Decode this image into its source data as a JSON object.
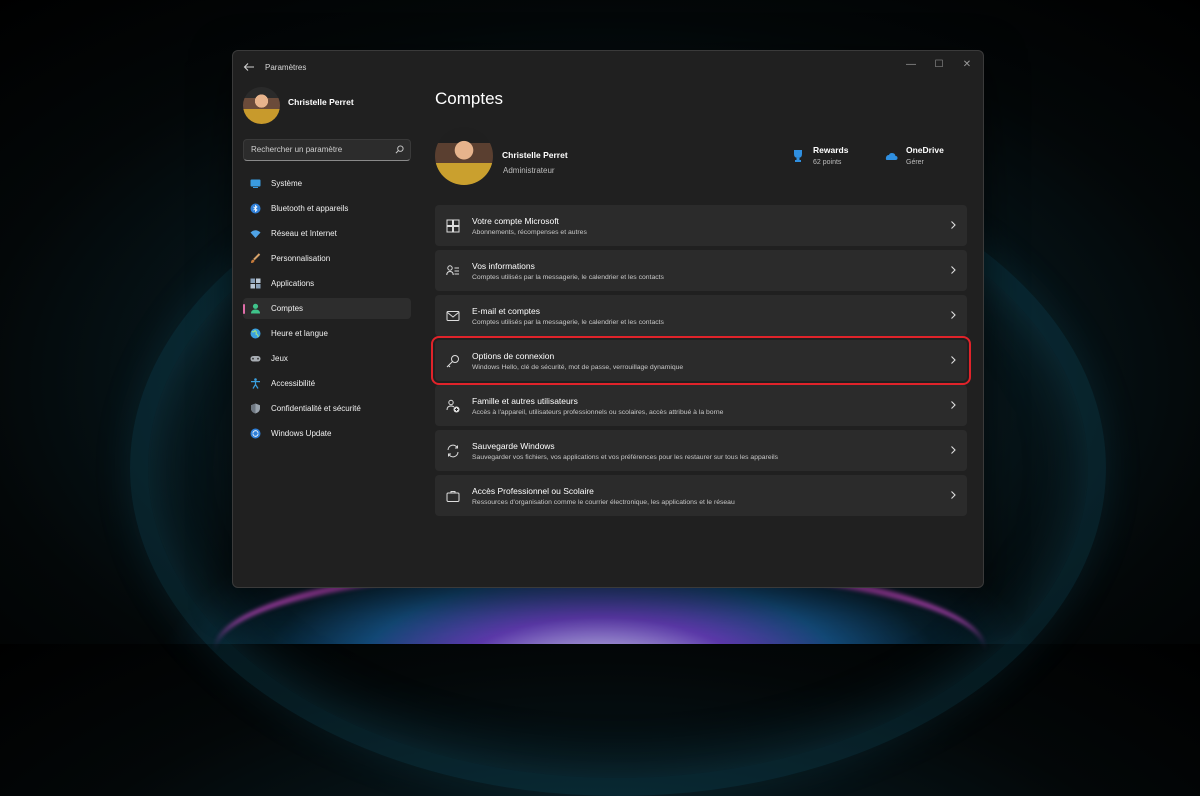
{
  "window": {
    "title": "Paramètres",
    "controls": {
      "minimize": "—",
      "maximize": "☐",
      "close": "✕"
    }
  },
  "sidebar": {
    "user_name": "Christelle Perret",
    "search": {
      "placeholder": "Rechercher un paramètre"
    },
    "items": [
      {
        "label": "Système",
        "icon": "system-icon",
        "active": false
      },
      {
        "label": "Bluetooth et appareils",
        "icon": "bluetooth-icon",
        "active": false
      },
      {
        "label": "Réseau et Internet",
        "icon": "wifi-icon",
        "active": false
      },
      {
        "label": "Personnalisation",
        "icon": "brush-icon",
        "active": false
      },
      {
        "label": "Applications",
        "icon": "apps-icon",
        "active": false
      },
      {
        "label": "Comptes",
        "icon": "accounts-icon",
        "active": true
      },
      {
        "label": "Heure et langue",
        "icon": "globe-icon",
        "active": false
      },
      {
        "label": "Jeux",
        "icon": "gamepad-icon",
        "active": false
      },
      {
        "label": "Accessibilité",
        "icon": "accessibility-icon",
        "active": false
      },
      {
        "label": "Confidentialité et sécurité",
        "icon": "shield-icon",
        "active": false
      },
      {
        "label": "Windows Update",
        "icon": "update-icon",
        "active": false
      }
    ]
  },
  "main": {
    "title": "Comptes",
    "profile": {
      "name": "Christelle Perret",
      "role": "Administrateur"
    },
    "rewards": {
      "label": "Rewards",
      "value": "62 points"
    },
    "onedrive": {
      "label": "OneDrive",
      "value": "Gérer"
    },
    "cards": [
      {
        "title": "Votre compte Microsoft",
        "subtitle": "Abonnements, récompenses et autres",
        "icon": "windows-logo-icon"
      },
      {
        "title": "Vos informations",
        "subtitle": "Comptes utilisés par la messagerie, le calendrier et les contacts",
        "icon": "person-details-icon"
      },
      {
        "title": "E-mail et comptes",
        "subtitle": "Comptes utilisés par la messagerie, le calendrier et les contacts",
        "icon": "mail-icon"
      },
      {
        "title": "Options de connexion",
        "subtitle": "Windows Hello, clé de sécurité, mot de passe, verrouillage dynamique",
        "icon": "key-icon",
        "highlighted": true
      },
      {
        "title": "Famille et autres utilisateurs",
        "subtitle": "Accès à l'appareil, utilisateurs professionnels ou scolaires, accès attribué à la borne",
        "icon": "family-icon"
      },
      {
        "title": "Sauvegarde Windows",
        "subtitle": "Sauvegarder vos fichiers, vos applications et vos préférences pour les restaurer sur tous les appareils",
        "icon": "backup-icon"
      },
      {
        "title": "Accès Professionnel ou Scolaire",
        "subtitle": "Ressources d'organisation comme le courrier électronique, les applications et le réseau",
        "icon": "briefcase-icon"
      }
    ]
  },
  "colors": {
    "accent": "#e06da8",
    "highlight": "#e0232a",
    "window_bg": "#202020",
    "card_bg": "#2b2b2b"
  }
}
